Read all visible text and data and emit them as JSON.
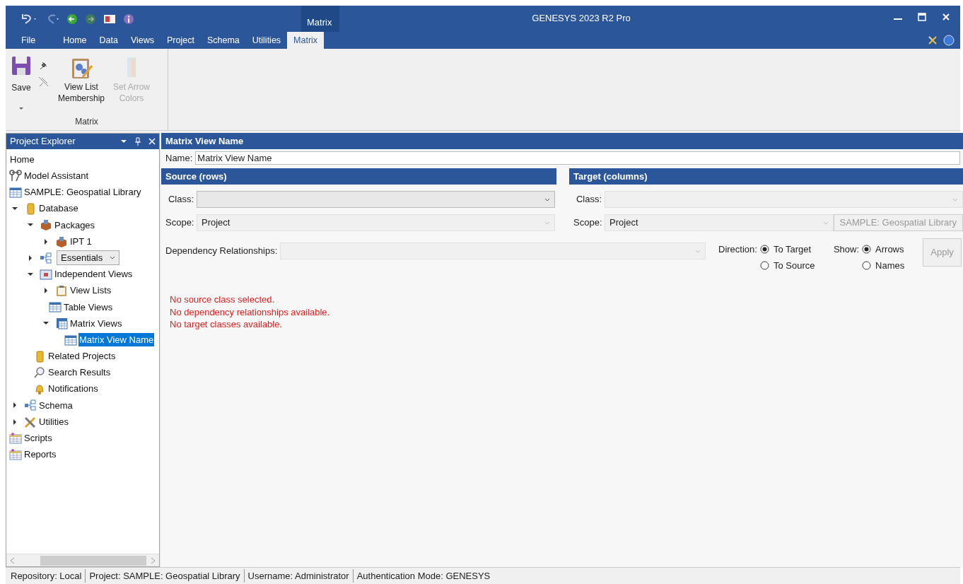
{
  "window": {
    "title": "GENESYS 2023 R2 Pro",
    "context_tab": "Matrix"
  },
  "ribbon_tabs": [
    {
      "label": "File",
      "selected": false
    },
    {
      "label": "Home",
      "selected": false
    },
    {
      "label": "Data",
      "selected": false
    },
    {
      "label": "Views",
      "selected": false
    },
    {
      "label": "Project",
      "selected": false
    },
    {
      "label": "Schema",
      "selected": false
    },
    {
      "label": "Utilities",
      "selected": false
    },
    {
      "label": "Matrix",
      "selected": true
    }
  ],
  "ribbon": {
    "group": "Matrix",
    "buttons": [
      {
        "kind": "save",
        "label": "Save",
        "disabled": false
      },
      {
        "kind": "pins"
      },
      {
        "kind": "membership",
        "label": "View List Membership",
        "disabled": false
      },
      {
        "kind": "arrows",
        "label": "Set Arrow Colors",
        "disabled": true
      }
    ]
  },
  "project_explorer": {
    "title": "Project Explorer",
    "items": [
      {
        "label": "Home",
        "kind": "plain",
        "selected": false
      },
      {
        "label": "Model Assistant",
        "kind": "assistant",
        "selected": false
      },
      {
        "label": "SAMPLE: Geospatial Library",
        "kind": "table",
        "selected": false
      },
      {
        "label": "Database",
        "kind": "database",
        "selected": false,
        "expanded": true,
        "children": [
          {
            "label": "Packages",
            "kind": "package",
            "selected": false,
            "expanded": true,
            "children": [
              {
                "label": "IPT 1",
                "kind": "package",
                "selected": false,
                "expanded": false
              }
            ]
          },
          {
            "label": "Essentials",
            "kind": "dropdown",
            "selected": false,
            "expanded": false
          },
          {
            "label": "Independent Views",
            "kind": "views",
            "selected": false,
            "expanded": true,
            "children": [
              {
                "label": "View Lists",
                "kind": "clipboard",
                "selected": false,
                "expanded": false
              },
              {
                "label": "Table Views",
                "kind": "table",
                "selected": false
              },
              {
                "label": "Matrix Views",
                "kind": "matrix",
                "selected": false,
                "expanded": true,
                "children": [
                  {
                    "label": "Matrix View Name",
                    "kind": "table",
                    "selected": true
                  }
                ]
              }
            ]
          },
          {
            "label": "Related Projects",
            "kind": "database",
            "selected": false
          },
          {
            "label": "Search Results",
            "kind": "search",
            "selected": false
          },
          {
            "label": "Notifications",
            "kind": "bell",
            "selected": false
          }
        ]
      },
      {
        "label": "Schema",
        "kind": "schema",
        "selected": false,
        "expanded": false
      },
      {
        "label": "Utilities",
        "kind": "tools",
        "selected": false,
        "expanded": false
      },
      {
        "label": "Scripts",
        "kind": "calendar",
        "selected": false
      },
      {
        "label": "Reports",
        "kind": "calendar",
        "selected": false
      }
    ]
  },
  "matrix": {
    "title": "Matrix View Name",
    "name_label": "Name:",
    "name_value": "Matrix View Name",
    "source": {
      "title": "Source (rows)",
      "class_label": "Class:",
      "scope_label": "Scope:",
      "scope_value": "Project"
    },
    "target": {
      "title": "Target (columns)",
      "class_label": "Class:",
      "scope_label": "Scope:",
      "scope_value": "Project",
      "project_button": "SAMPLE: Geospatial Library"
    },
    "dependency_label": "Dependency Relationships:",
    "direction": {
      "label": "Direction:",
      "options": [
        {
          "label": "To Target",
          "selected": true
        },
        {
          "label": "To Source",
          "selected": false
        }
      ]
    },
    "show": {
      "label": "Show:",
      "options": [
        {
          "label": "Arrows",
          "selected": true
        },
        {
          "label": "Names",
          "selected": false
        }
      ]
    },
    "apply_button": "Apply",
    "messages": [
      "No source class selected.",
      "No dependency relationships available.",
      "No target classes available."
    ]
  },
  "status_bar": [
    "Repository: Local",
    "Project: SAMPLE: Geospatial Library",
    "Username: Administrator",
    "Authentication Mode: GENESYS"
  ]
}
